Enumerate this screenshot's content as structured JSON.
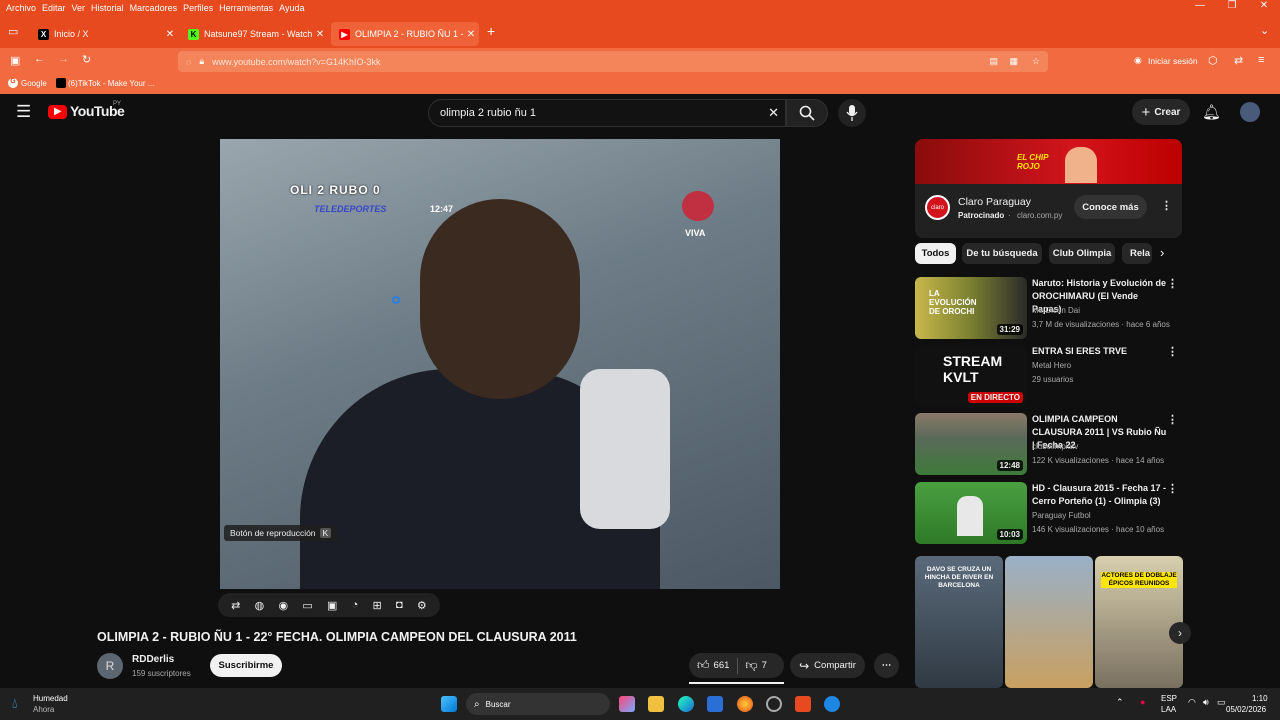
{
  "browser": {
    "menu": [
      "Archivo",
      "Editar",
      "Ver",
      "Historial",
      "Marcadores",
      "Perfiles",
      "Herramientas",
      "Ayuda"
    ],
    "tabs": [
      {
        "title": "Inicio / X",
        "icon": "x-icon"
      },
      {
        "title": "Natsune97 Stream - Watch Live",
        "icon": "kick-icon"
      },
      {
        "title": "OLIMPIA 2 - RUBIO ÑU 1 - 22° FECHA",
        "icon": "youtube-icon"
      }
    ],
    "url": "www.youtube.com/watch?v=G14KhIO-3kk",
    "signin": "Iniciar sesión",
    "bookmarks": [
      "Google",
      "(6)TikTok - Make Your ..."
    ]
  },
  "youtube": {
    "logo": "YouTube",
    "region": "PY",
    "search_query": "olimpia 2 rubio ñu 1",
    "create_label": "Crear",
    "player": {
      "scoreboard": "OLI 2 RUBO 0",
      "broadcaster": "TELEDEPORTES",
      "clock": "12:47",
      "tv_logo": "VIVA",
      "tooltip": "Botón de reproducción",
      "tooltip_key": "K"
    },
    "video_title": "OLIMPIA 2 - RUBIO ÑU 1 - 22° FECHA. OLIMPIA CAMPEON DEL CLAUSURA 2011",
    "channel": {
      "initial": "R",
      "name": "RDDerlis",
      "subs": "159 suscriptores",
      "subscribe": "Suscribirme"
    },
    "likes": "661",
    "dislikes": "7",
    "share": "Compartir",
    "ad": {
      "banner_text": "EL CHIP ROJO",
      "name": "Claro Paraguay",
      "sponsored": "Patrocinado",
      "domain": "claro.com.py",
      "cta": "Conoce más"
    },
    "chips": [
      "Todos",
      "De tu búsqueda",
      "Club Olimpia",
      "Rela"
    ],
    "recommendations": [
      {
        "title": "Naruto: Historia y Evolución de OROCHIMARU (El Vende Papas)",
        "channel": "Me Dicen Dai",
        "meta": "3,7 M de visualizaciones · hace 6 años",
        "duration": "31:29",
        "thumb_text": "LA EVOLUCIÓN DE OROCHI"
      },
      {
        "title": "ENTRA SI ERES TRVE",
        "channel": "Metal Hero",
        "meta": "29 usuarios",
        "duration": "EN DIRECTO",
        "thumb_text": "STREAM KVLT"
      },
      {
        "title": "OLIMPIA CAMPEON CLAUSURA 2011 | VS Rubio Ñu | Fecha 22",
        "channel": "clubolimpiatv",
        "meta": "122 K visualizaciones · hace 14 años",
        "duration": "12:48",
        "thumb_text": ""
      },
      {
        "title": "HD - Clausura 2015 - Fecha 17 - Cerro Porteño (1) - Olimpia (3)",
        "channel": "Paraguay Futbol",
        "meta": "146 K visualizaciones · hace 10 años",
        "duration": "10:03",
        "thumb_text": ""
      }
    ],
    "shorts": [
      {
        "text": "DAVO SE CRUZA UN HINCHA DE RIVER EN BARCELONA"
      },
      {
        "text": ""
      },
      {
        "text": "ACTORES DE DOBLAJE ÉPICOS REUNIDOS"
      }
    ]
  },
  "taskbar": {
    "weather_label": "Humedad",
    "weather_sub": "Ahora",
    "search": "Buscar",
    "lang": "ESP",
    "lang_sub": "LAA",
    "time": "1:10",
    "date": "05/02/2026"
  }
}
